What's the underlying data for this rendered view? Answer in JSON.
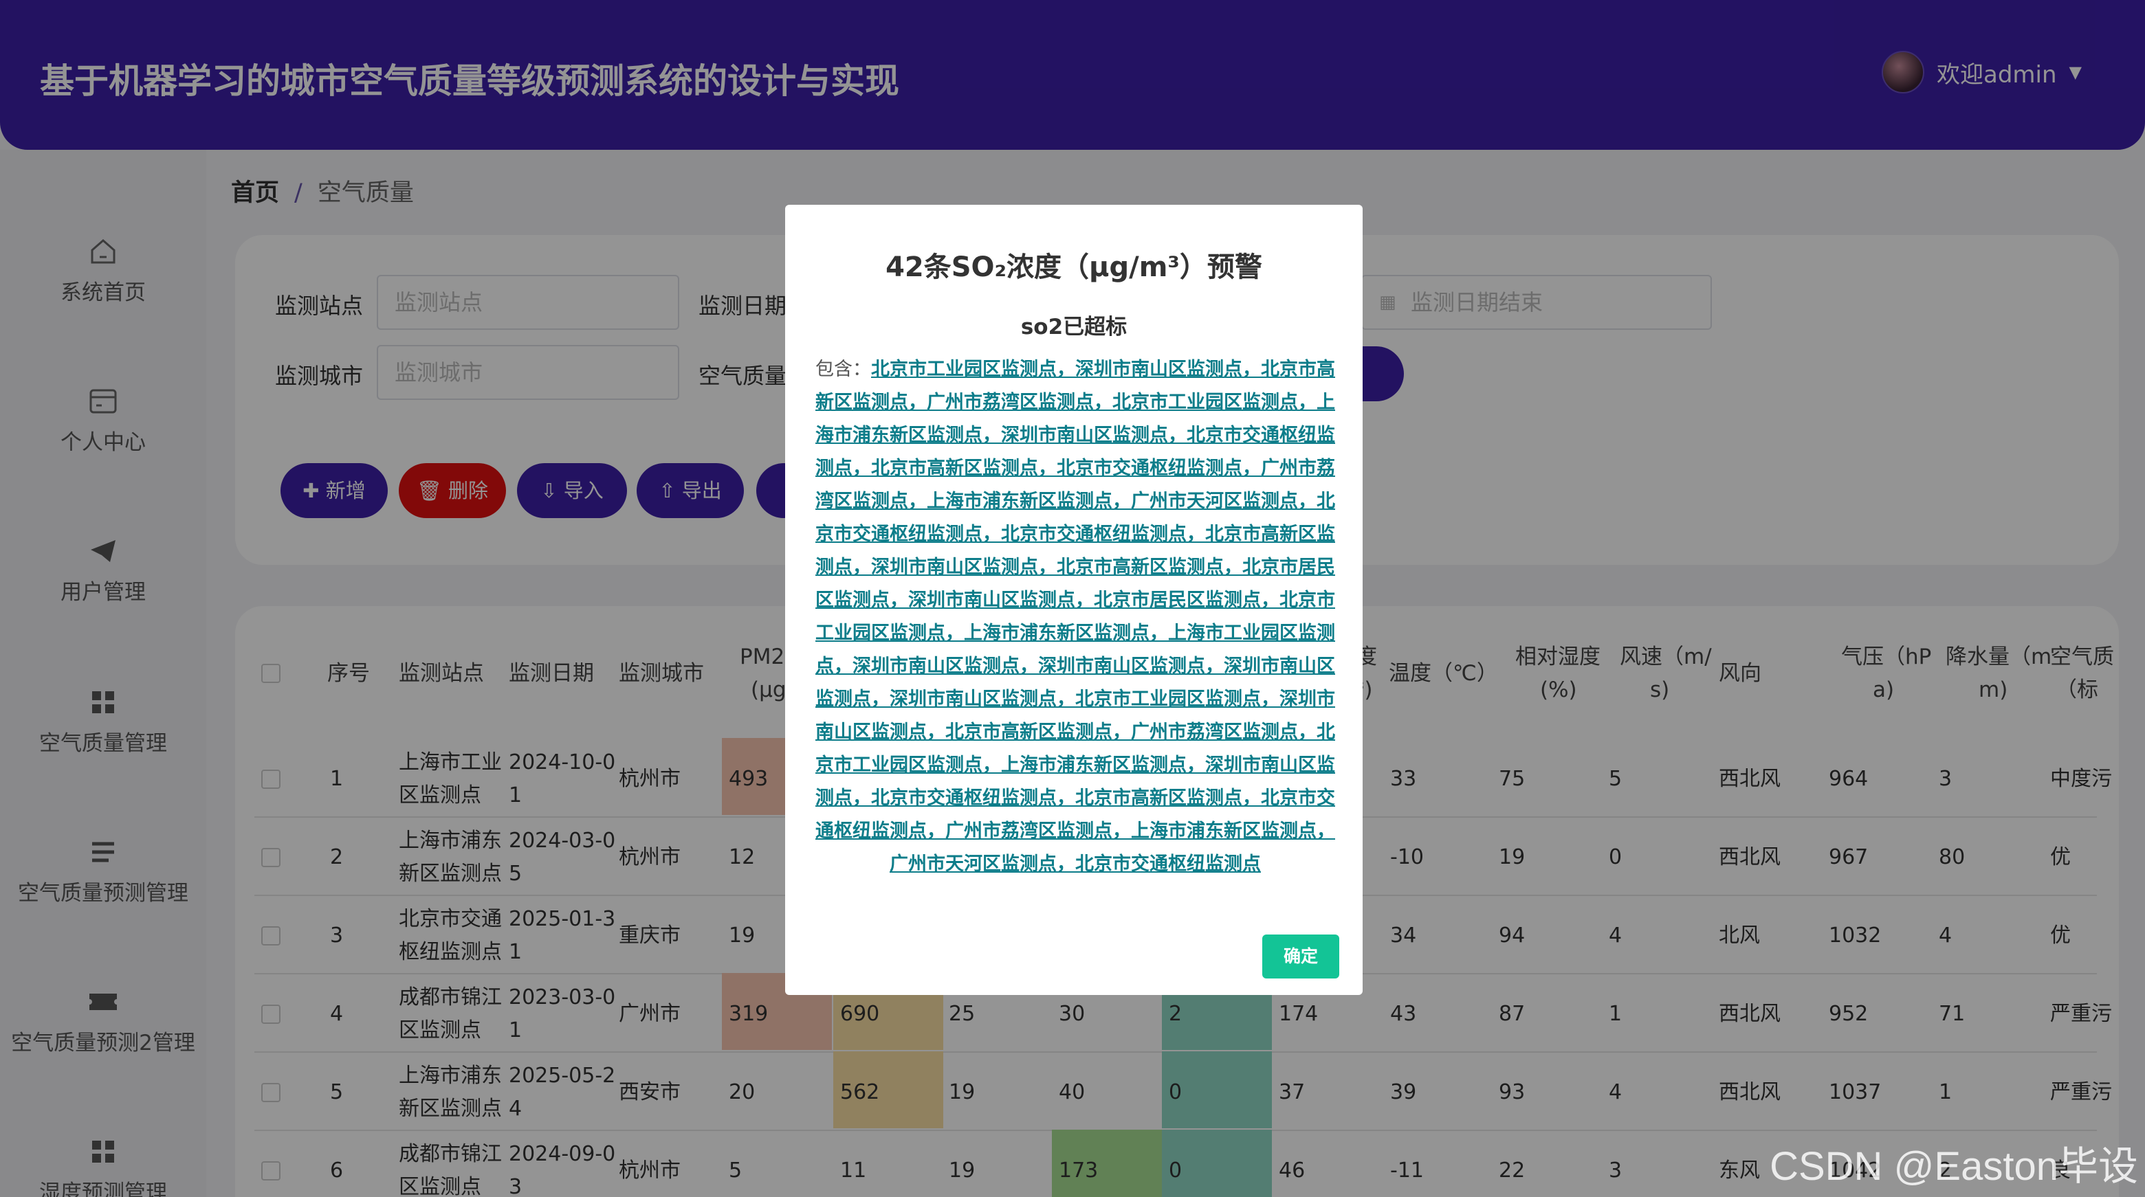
{
  "header": {
    "title": "基于机器学习的城市空气质量等级预测系统的设计与实现",
    "user": "欢迎admin"
  },
  "sidebar": {
    "items": [
      {
        "label": "系统首页",
        "icon": "home-icon"
      },
      {
        "label": "个人中心",
        "icon": "card-icon"
      },
      {
        "label": "用户管理",
        "icon": "send-icon"
      },
      {
        "label": "空气质量管理",
        "icon": "grid-icon"
      },
      {
        "label": "空气质量预测管理",
        "icon": "list-icon"
      },
      {
        "label": "空气质量预测2管理",
        "icon": "ticket-icon"
      },
      {
        "label": "湿度预测管理",
        "icon": "grid-icon"
      }
    ]
  },
  "breadcrumb": {
    "home": "首页",
    "sep": "/",
    "current": "空气质量"
  },
  "search": {
    "station_label": "监测站点",
    "station_placeholder": "监测站点",
    "date_label": "监测日期",
    "date_end_placeholder": "监测日期结束",
    "city_label": "监测城市",
    "city_placeholder": "监测城市",
    "quality_label": "空气质量"
  },
  "toolbar": {
    "add": "新增",
    "delete": "删除",
    "import": "导入",
    "export": "导出"
  },
  "table": {
    "headers": [
      "序号",
      "监测站点",
      "监测日期",
      "监测城市",
      "PM2",
      "(μg",
      "度",
      "³)",
      "温度（℃）",
      "相对湿度",
      "(%)",
      "风速（m/",
      "s)",
      "风向",
      "气压（hP",
      "a)",
      "降水量（m",
      "m)",
      "空气质",
      "（标"
    ],
    "rows": [
      {
        "no": "1",
        "station": [
          "上海市工业",
          "区监测点"
        ],
        "date": [
          "2024-10-0",
          "1"
        ],
        "city": "杭州市",
        "c1": "493",
        "c2": "",
        "c3": "",
        "c4": "",
        "c5": "",
        "c6": "",
        "temp": "33",
        "rh": "75",
        "ws": "5",
        "wd": "西北风",
        "ap": "964",
        "rain": "3",
        "aq": "中度污"
      },
      {
        "no": "2",
        "station": [
          "上海市浦东",
          "新区监测点"
        ],
        "date": [
          "2024-03-0",
          "5"
        ],
        "city": "杭州市",
        "c1": "12",
        "c2": "",
        "c3": "",
        "c4": "",
        "c5": "",
        "c6": "",
        "temp": "-10",
        "rh": "19",
        "ws": "0",
        "wd": "西北风",
        "ap": "967",
        "rain": "80",
        "aq": "优"
      },
      {
        "no": "3",
        "station": [
          "北京市交通",
          "枢纽监测点"
        ],
        "date": [
          "2025-01-3",
          "1"
        ],
        "city": "重庆市",
        "c1": "19",
        "c2": "",
        "c3": "",
        "c4": "",
        "c5": "",
        "c6": "",
        "temp": "34",
        "rh": "94",
        "ws": "4",
        "wd": "北风",
        "ap": "1032",
        "rain": "4",
        "aq": "优"
      },
      {
        "no": "4",
        "station": [
          "成都市锦江",
          "区监测点"
        ],
        "date": [
          "2023-03-0",
          "1"
        ],
        "city": "广州市",
        "c1": "319",
        "c2": "690",
        "c3": "25",
        "c4": "30",
        "c5": "2",
        "c6": "174",
        "temp": "43",
        "rh": "87",
        "ws": "1",
        "wd": "西北风",
        "ap": "952",
        "rain": "71",
        "aq": "严重污"
      },
      {
        "no": "5",
        "station": [
          "上海市浦东",
          "新区监测点"
        ],
        "date": [
          "2025-05-2",
          "4"
        ],
        "city": "西安市",
        "c1": "20",
        "c2": "562",
        "c3": "19",
        "c4": "40",
        "c5": "0",
        "c6": "37",
        "temp": "39",
        "rh": "93",
        "ws": "4",
        "wd": "西北风",
        "ap": "1037",
        "rain": "1",
        "aq": "严重污"
      },
      {
        "no": "6",
        "station": [
          "成都市锦江",
          "区监测点"
        ],
        "date": [
          "2024-09-0",
          "3"
        ],
        "city": "杭州市",
        "c1": "5",
        "c2": "11",
        "c3": "19",
        "c4": "173",
        "c5": "0",
        "c6": "46",
        "temp": "-11",
        "rh": "22",
        "ws": "3",
        "wd": "东风",
        "ap": "1042",
        "rain": "2",
        "aq": "良"
      }
    ]
  },
  "modal": {
    "title": "42条SO₂浓度（μg/m³）预警",
    "subtitle": "so2已超标",
    "prefix": "包含：",
    "stations": "北京市工业园区监测点，深圳市南山区监测点，北京市高新区监测点，广州市荔湾区监测点，北京市工业园区监测点，上海市浦东新区监测点，深圳市南山区监测点，北京市交通枢纽监测点，北京市高新区监测点，北京市交通枢纽监测点，广州市荔湾区监测点，上海市浦东新区监测点，广州市天河区监测点，北京市交通枢纽监测点，北京市交通枢纽监测点，北京市高新区监测点，深圳市南山区监测点，北京市高新区监测点，北京市居民区监测点，深圳市南山区监测点，北京市居民区监测点，北京市工业园区监测点，上海市浦东新区监测点，上海市工业园区监测点，深圳市南山区监测点，深圳市南山区监测点，深圳市南山区监测点，深圳市南山区监测点，北京市工业园区监测点，深圳市南山区监测点，北京市高新区监测点，广州市荔湾区监测点，北京市工业园区监测点，上海市浦东新区监测点，深圳市南山区监测点，北京市交通枢纽监测点，北京市高新区监测点，北京市交通枢纽监测点，广州市荔湾区监测点，上海市浦东新区监测点，广州市天河区监测点，北京市交通枢纽监测点",
    "ok": "确定"
  },
  "watermark": "CSDN @Easton毕设",
  "colors": {
    "header": "#3d1fa8",
    "danger": "#e01010",
    "primary": "#3d1fa8",
    "ok": "#13c496",
    "link": "#0d7d8a"
  }
}
